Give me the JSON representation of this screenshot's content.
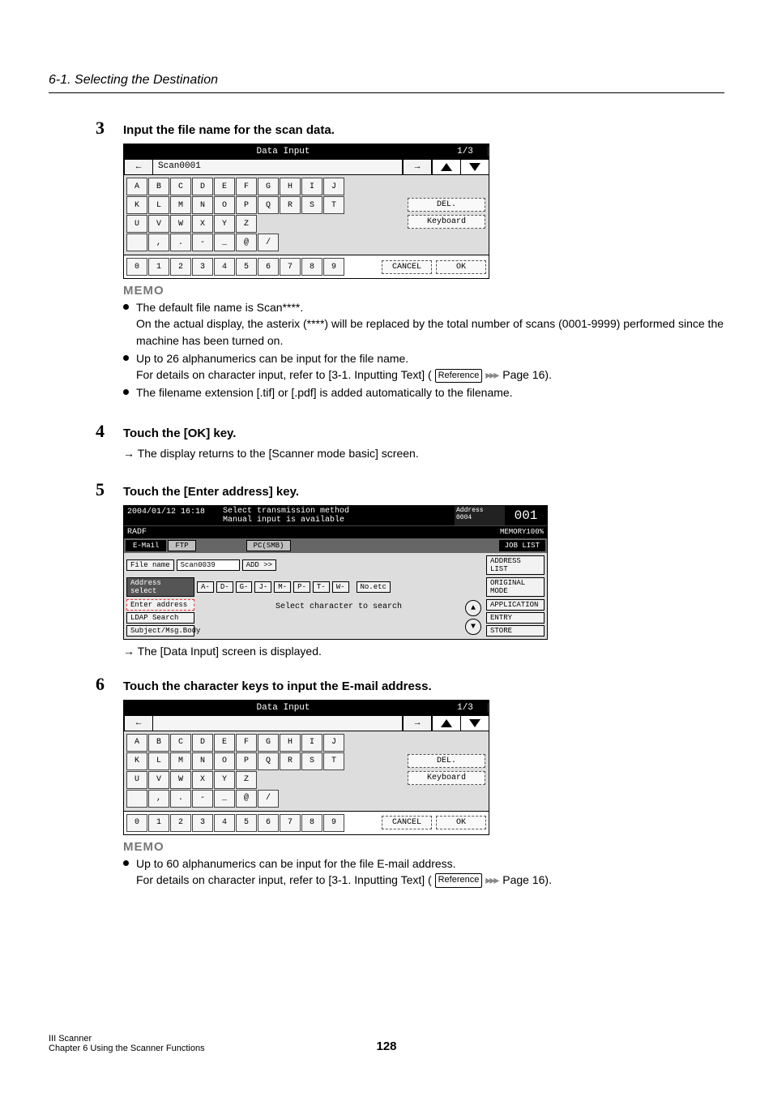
{
  "header": "6-1. Selecting the Destination",
  "steps": {
    "s3": {
      "num": "3",
      "title": "Input the file name for the scan data."
    },
    "s4": {
      "num": "4",
      "title": "Touch the [OK] key.",
      "sub": "The display returns to the [Scanner mode basic] screen."
    },
    "s5": {
      "num": "5",
      "title": "Touch the [Enter address] key.",
      "sub": "The [Data Input] screen is displayed."
    },
    "s6": {
      "num": "6",
      "title": "Touch the character keys to input the E-mail address."
    }
  },
  "memo_heading": "MEMO",
  "memo1": {
    "l1a": "The default file name is Scan****.",
    "l1b": "On the actual display, the asterix (****) will be replaced by the total number of scans (0001-9999) performed since the machine has been turned on.",
    "l2a": "Up to 26 alphanumerics can be input for the file name.",
    "l2b_prefix": "For details on character input, refer to [3-1. Inputting Text] (",
    "l2b_ref": "Reference",
    "l2b_suffix": " Page 16).",
    "l3": "The filename extension [.tif] or [.pdf] is added automatically to the filename."
  },
  "memo2": {
    "l1a": "Up to 60 alphanumerics can be input for the file E-mail address.",
    "l1b_prefix": "For details on character input, refer to [3-1. Inputting Text] (",
    "l1b_ref": "Reference",
    "l1b_suffix": " Page 16)."
  },
  "data_input_panel1": {
    "title": "Data Input",
    "page": "1/3",
    "value": "Scan0001",
    "row1": [
      "A",
      "B",
      "C",
      "D",
      "E",
      "F",
      "G",
      "H",
      "I",
      "J"
    ],
    "row2": [
      "K",
      "L",
      "M",
      "N",
      "O",
      "P",
      "Q",
      "R",
      "S",
      "T"
    ],
    "row3": [
      "U",
      "V",
      "W",
      "X",
      "Y",
      "Z"
    ],
    "row4": [
      " ",
      ",",
      ".",
      "-",
      "_",
      "@",
      "/"
    ],
    "nums": [
      "0",
      "1",
      "2",
      "3",
      "4",
      "5",
      "6",
      "7",
      "8",
      "9"
    ],
    "del": "DEL.",
    "keyboard": "Keyboard",
    "cancel": "CANCEL",
    "ok": "OK"
  },
  "data_input_panel2": {
    "title": "Data Input",
    "page": "1/3",
    "value": "",
    "row1": [
      "A",
      "B",
      "C",
      "D",
      "E",
      "F",
      "G",
      "H",
      "I",
      "J"
    ],
    "row2": [
      "K",
      "L",
      "M",
      "N",
      "O",
      "P",
      "Q",
      "R",
      "S",
      "T"
    ],
    "row3": [
      "U",
      "V",
      "W",
      "X",
      "Y",
      "Z"
    ],
    "row4": [
      " ",
      ",",
      ".",
      "-",
      "_",
      "@",
      "/"
    ],
    "nums": [
      "0",
      "1",
      "2",
      "3",
      "4",
      "5",
      "6",
      "7",
      "8",
      "9"
    ],
    "del": "DEL.",
    "keyboard": "Keyboard",
    "cancel": "CANCEL",
    "ok": "OK"
  },
  "scanner_panel": {
    "date": "2004/01/12 16:18",
    "msg1": "Select transmission method",
    "msg2": "Manual input is available",
    "radf": "RADF",
    "addr_label": "Address",
    "addr_count": "0004",
    "counter": "001",
    "memory": "MEMORY100%",
    "tab_email": "E-Mail",
    "tab_ftp": "FTP",
    "tab_pcsmb": "PC(SMB)",
    "joblist": "JOB LIST",
    "file_name_label": "File name",
    "file_name_value": "Scan0039",
    "add_btn": "ADD >>",
    "address_list": "ADDRESS LIST",
    "addr_select": "Address select",
    "letters": [
      "A-",
      "D-",
      "G-",
      "J-",
      "M-",
      "P-",
      "T-",
      "W-"
    ],
    "no_etc": "No.etc",
    "original_mode": "ORIGINAL MODE",
    "enter_address": "Enter address",
    "application": "APPLICATION",
    "ldap_search": "LDAP Search",
    "entry": "ENTRY",
    "subject": "Subject/Msg.Body",
    "store": "STORE",
    "select_char": "Select character to search"
  },
  "footer": {
    "part": "III Scanner",
    "chapter": "Chapter 6 Using the Scanner Functions",
    "page": "128"
  }
}
